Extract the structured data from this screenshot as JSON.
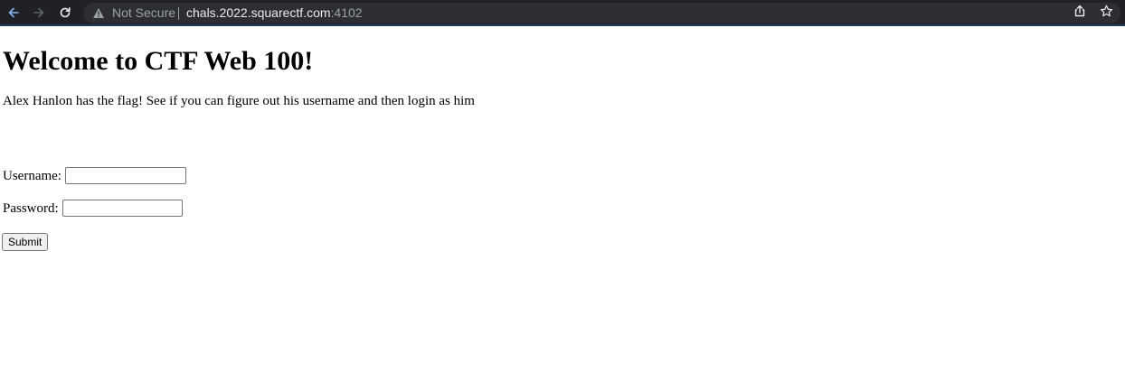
{
  "browser": {
    "security_label": "Not Secure",
    "url_host": "chals.2022.squarectf.com",
    "url_port": ":4102",
    "icons": {
      "back": "back-arrow-icon",
      "forward": "forward-arrow-icon",
      "reload": "reload-icon",
      "warning": "warning-triangle-icon",
      "share": "share-icon",
      "bookmark": "bookmark-star-icon"
    },
    "colors": {
      "toolbar_bg": "#202124",
      "omnibox_bg": "#2d2e31",
      "url_text": "#e8eaed",
      "muted_text": "#9aa0a6"
    }
  },
  "page": {
    "heading": "Welcome to CTF Web 100!",
    "intro": "Alex Hanlon has the flag! See if you can figure out his username and then login as him",
    "form": {
      "username_label": "Username:",
      "username_value": "",
      "password_label": "Password:",
      "password_value": "",
      "submit_label": "Submit"
    }
  }
}
